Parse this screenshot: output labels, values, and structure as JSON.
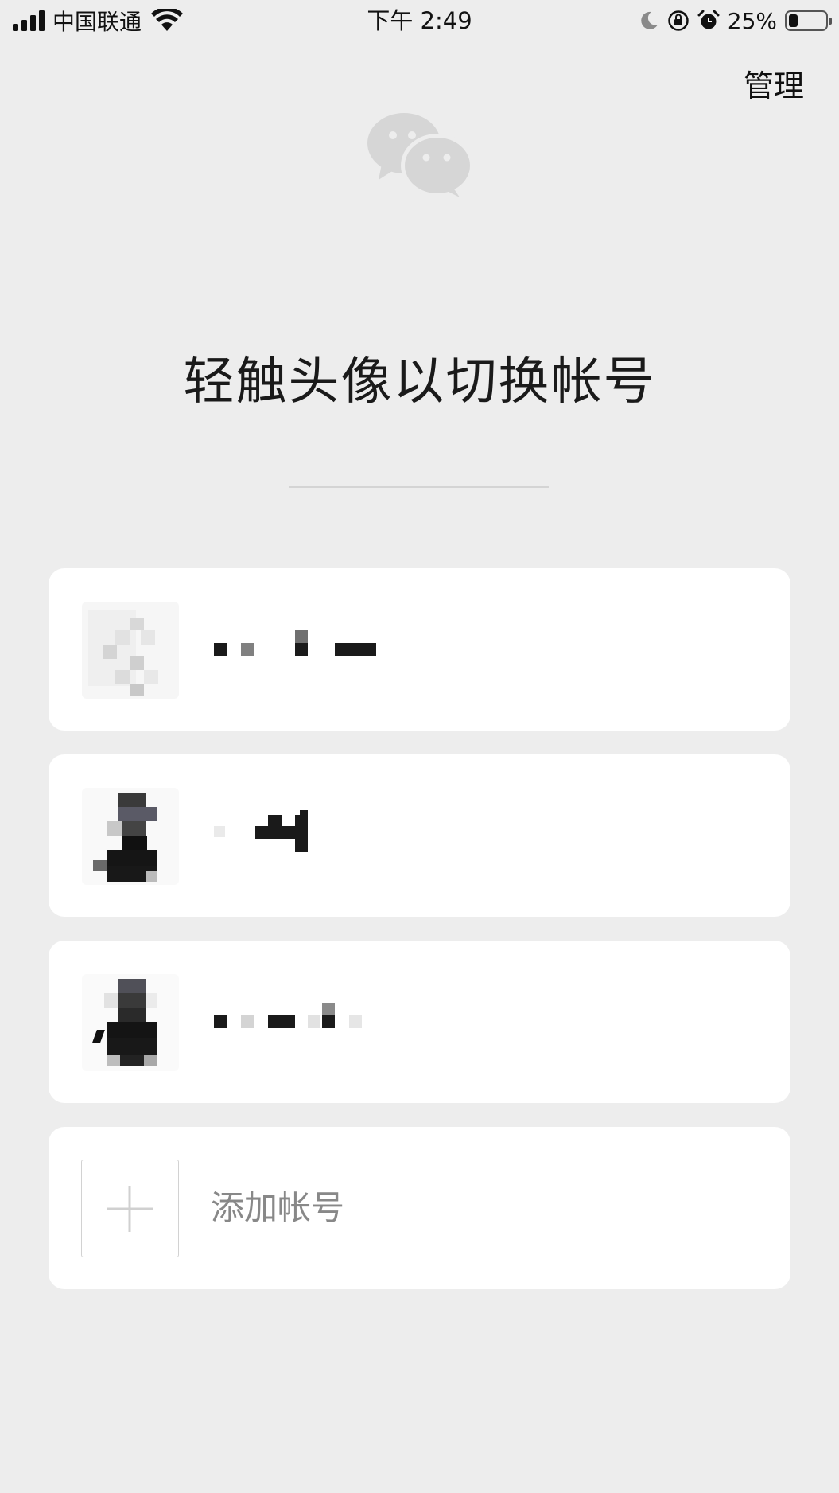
{
  "status_bar": {
    "carrier": "中国联通",
    "time": "下午 2:49",
    "battery_percent": "25%",
    "battery_level": 0.25,
    "icons": [
      "signal-icon",
      "wifi-icon",
      "moon-icon",
      "orientation-lock-icon",
      "alarm-icon",
      "battery-icon"
    ]
  },
  "header": {
    "manage_label": "管理",
    "logo_icon": "wechat-logo-icon"
  },
  "title": "轻触头像以切换帐号",
  "accounts": [
    {
      "avatar_icon": "avatar-icon",
      "name_redacted": true
    },
    {
      "avatar_icon": "avatar-icon",
      "name_redacted": true
    },
    {
      "avatar_icon": "avatar-icon",
      "name_redacted": true
    }
  ],
  "add_account": {
    "label": "添加帐号",
    "icon": "plus-icon"
  },
  "colors": {
    "background": "#ededed",
    "card": "#ffffff",
    "logo": "#d6d6d6",
    "muted_text": "#888888"
  }
}
